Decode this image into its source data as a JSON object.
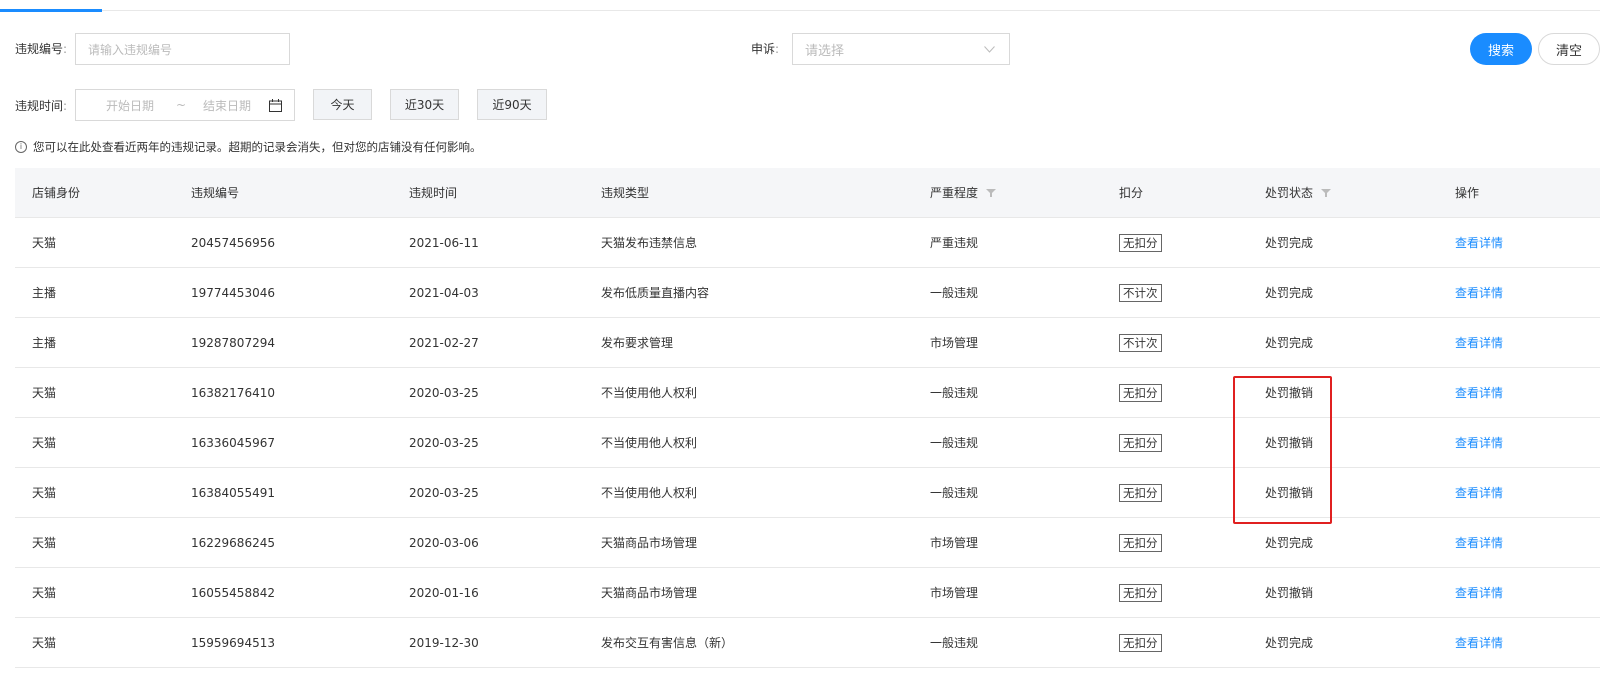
{
  "filters": {
    "violation_no_label": "违规编号",
    "violation_no_placeholder": "请输入违规编号",
    "appeal_label": "申诉",
    "appeal_placeholder": "请选择",
    "time_label": "违规时间",
    "start_placeholder": "开始日期",
    "range_separator": "~",
    "end_placeholder": "结束日期",
    "colon": ":"
  },
  "buttons": {
    "search": "搜索",
    "clear": "清空",
    "today": "今天",
    "last30": "近30天",
    "last90": "近90天"
  },
  "notice": "您可以在此处查看近两年的违规记录。超期的记录会消失，但对您的店铺没有任何影响。",
  "table": {
    "headers": [
      "店铺身份",
      "违规编号",
      "违规时间",
      "违规类型",
      "严重程度",
      "扣分",
      "处罚状态",
      "操作"
    ],
    "rows": [
      {
        "identity": "天猫",
        "no": "20457456956",
        "time": "2021-06-11",
        "type": "天猫发布违禁信息",
        "severity": "严重违规",
        "deduct": "无扣分",
        "status": "处罚完成",
        "action": "查看详情"
      },
      {
        "identity": "主播",
        "no": "19774453046",
        "time": "2021-04-03",
        "type": "发布低质量直播内容",
        "severity": "一般违规",
        "deduct": "不计次",
        "status": "处罚完成",
        "action": "查看详情"
      },
      {
        "identity": "主播",
        "no": "19287807294",
        "time": "2021-02-27",
        "type": "发布要求管理",
        "severity": "市场管理",
        "deduct": "不计次",
        "status": "处罚完成",
        "action": "查看详情"
      },
      {
        "identity": "天猫",
        "no": "16382176410",
        "time": "2020-03-25",
        "type": "不当使用他人权利",
        "severity": "一般违规",
        "deduct": "无扣分",
        "status": "处罚撤销",
        "action": "查看详情"
      },
      {
        "identity": "天猫",
        "no": "16336045967",
        "time": "2020-03-25",
        "type": "不当使用他人权利",
        "severity": "一般违规",
        "deduct": "无扣分",
        "status": "处罚撤销",
        "action": "查看详情"
      },
      {
        "identity": "天猫",
        "no": "16384055491",
        "time": "2020-03-25",
        "type": "不当使用他人权利",
        "severity": "一般违规",
        "deduct": "无扣分",
        "status": "处罚撤销",
        "action": "查看详情"
      },
      {
        "identity": "天猫",
        "no": "16229686245",
        "time": "2020-03-06",
        "type": "天猫商品市场管理",
        "severity": "市场管理",
        "deduct": "无扣分",
        "status": "处罚完成",
        "action": "查看详情"
      },
      {
        "identity": "天猫",
        "no": "16055458842",
        "time": "2020-01-16",
        "type": "天猫商品市场管理",
        "severity": "市场管理",
        "deduct": "无扣分",
        "status": "处罚撤销",
        "action": "查看详情"
      },
      {
        "identity": "天猫",
        "no": "15959694513",
        "time": "2019-12-30",
        "type": "发布交互有害信息（新）",
        "severity": "一般违规",
        "deduct": "无扣分",
        "status": "处罚完成",
        "action": "查看详情"
      }
    ]
  },
  "colors": {
    "accent": "#1a8cff",
    "highlight": "#e02020"
  }
}
